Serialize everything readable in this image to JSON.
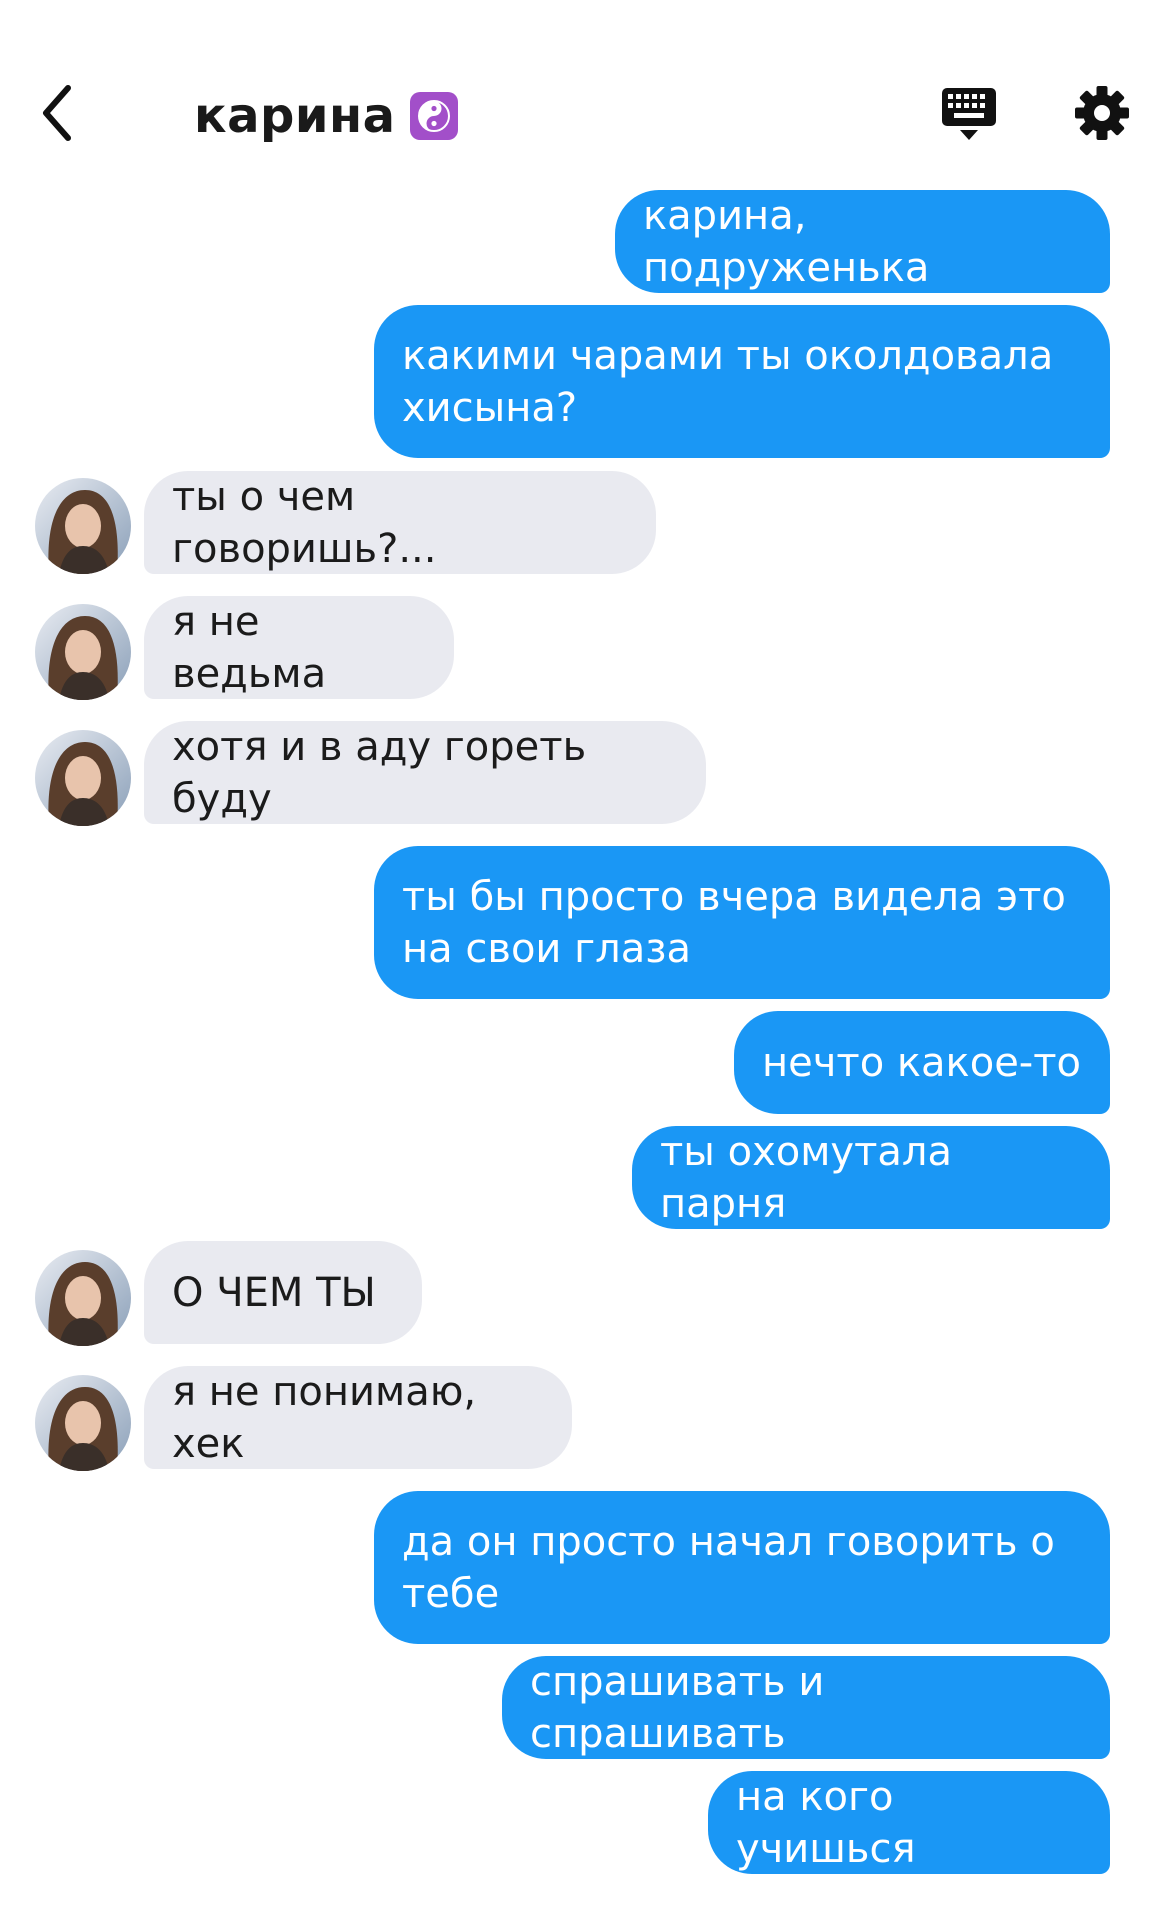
{
  "header": {
    "title": "карина",
    "title_badge_icon": "yin-yang-icon",
    "back_icon": "chevron-left-icon",
    "keyboard_icon": "keyboard-icon",
    "settings_icon": "gear-icon"
  },
  "colors": {
    "outgoing_bubble": "#1a97f5",
    "incoming_bubble": "#e9eaf0",
    "badge": "#a24fc9"
  },
  "messages": [
    {
      "direction": "out",
      "text": "карина, подруженька"
    },
    {
      "direction": "out",
      "text": "какими чарами ты околдовала\nхисына?"
    },
    {
      "direction": "in",
      "text": "ты о чем говоришь?..."
    },
    {
      "direction": "in",
      "text": "я не ведьма"
    },
    {
      "direction": "in",
      "text": "хотя и в аду гореть буду"
    },
    {
      "direction": "out",
      "text": "ты бы просто вчера видела это\nна свои глаза"
    },
    {
      "direction": "out",
      "text": "нечто какое-то"
    },
    {
      "direction": "out",
      "text": "ты охомутала парня"
    },
    {
      "direction": "in",
      "text": "О ЧЕМ ТЫ"
    },
    {
      "direction": "in",
      "text": "я не понимаю, хек"
    },
    {
      "direction": "out",
      "text": "да он просто начал говорить о\nтебе"
    },
    {
      "direction": "out",
      "text": "спрашивать и спрашивать"
    },
    {
      "direction": "out",
      "text": "на кого учишься"
    }
  ]
}
